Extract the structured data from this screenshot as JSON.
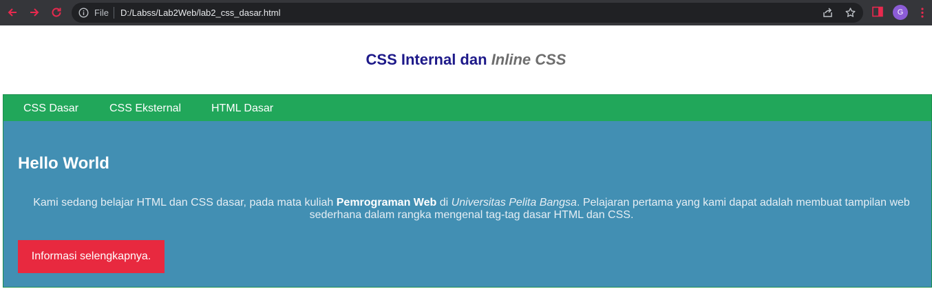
{
  "browser": {
    "scheme_label": "File",
    "url": "D:/Labss/Lab2Web/lab2_css_dasar.html",
    "profile_initial": "G",
    "colors": {
      "chrome": "#35363a",
      "omnibox": "#202124",
      "nav_icon": "#e8294e",
      "avatar": "#8c5cd6"
    }
  },
  "page": {
    "title_main": "CSS Internal dan",
    "title_italic": "Inline CSS",
    "nav": [
      "CSS Dasar",
      "CSS Eksternal",
      "HTML Dasar"
    ],
    "hero": {
      "heading": "Hello World",
      "text_1": "Kami sedang belajar HTML dan CSS dasar, pada mata kuliah",
      "text_bold": "Pemrograman Web",
      "text_2": "di",
      "text_italic": "Universitas Pelita Bangsa",
      "text_3": ". Pelajaran pertama yang kami dapat adalah membuat tampilan web sederhana dalam rangka mengenal tag-tag dasar HTML dan CSS.",
      "button_label": "Informasi selengkapnya."
    },
    "colors": {
      "title": "#1d1989",
      "title_italic": "#6e6e6e",
      "navbar": "#21a75a",
      "hero": "#428fb3",
      "button": "#e8293f"
    }
  }
}
